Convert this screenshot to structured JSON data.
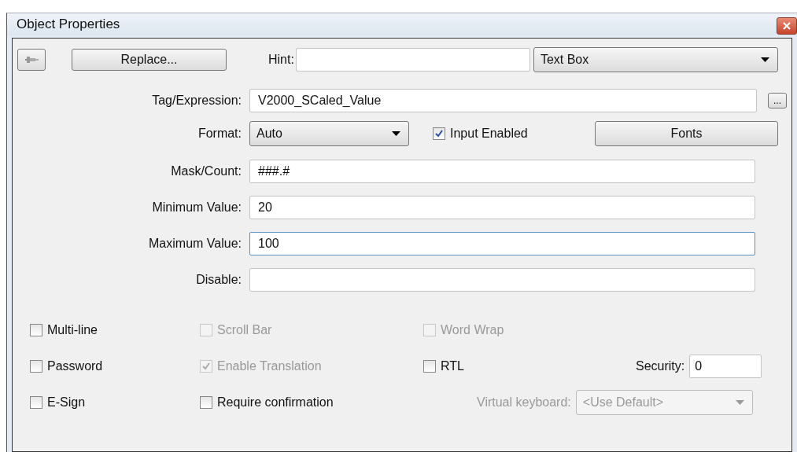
{
  "window": {
    "title": "Object Properties"
  },
  "toolbar": {
    "replace_button": "Replace...",
    "hint": {
      "label": "Hint:"
    },
    "type_select": {
      "value": "Text Box"
    }
  },
  "tag_expression": {
    "label": "Tag/Expression:",
    "value": "V2000_SCaled_Value",
    "browse_button": "..."
  },
  "format": {
    "label": "Format:",
    "value": "Auto"
  },
  "input_enabled": {
    "label": "Input Enabled",
    "checked": true,
    "disabled": false
  },
  "fonts_button": "Fonts",
  "fields": [
    {
      "label": "Mask/Count:",
      "value": "###.#",
      "focused": false
    },
    {
      "label": "Minimum Value:",
      "value": "20",
      "focused": false
    },
    {
      "label": "Maximum Value:",
      "value": "100",
      "focused": true
    },
    {
      "label": "Disable:",
      "focused": false
    }
  ],
  "option_rows": [
    [
      {
        "label": "Multi-line",
        "checked": false,
        "disabled": false
      },
      {
        "label": "Scroll Bar",
        "checked": false,
        "disabled": true
      },
      {
        "label": "Word Wrap",
        "checked": false,
        "disabled": true
      }
    ],
    [
      {
        "label": "Password",
        "checked": false,
        "disabled": false
      },
      {
        "label": "Enable Translation",
        "checked": true,
        "disabled": true
      },
      {
        "label": "RTL",
        "checked": false,
        "disabled": false
      }
    ],
    [
      {
        "label": "E-Sign",
        "checked": false,
        "disabled": false
      },
      {
        "label": "Require confirmation",
        "checked": false,
        "disabled": false
      }
    ]
  ],
  "security": {
    "label": "Security:",
    "value": "0"
  },
  "virtual_keyboard": {
    "label": "Virtual keyboard:",
    "value": "<Use Default>",
    "disabled": true
  }
}
